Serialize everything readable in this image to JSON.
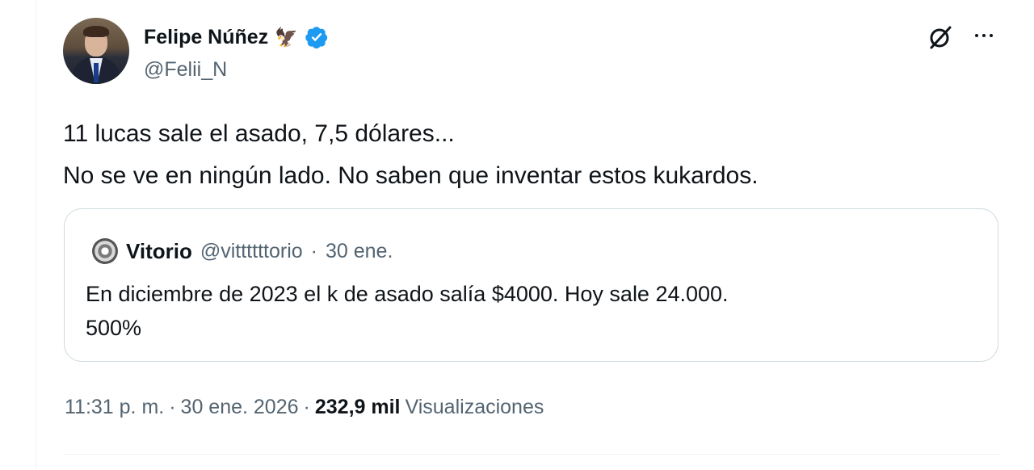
{
  "author": {
    "display_name": "Felipe Núñez",
    "emoji": "🦅",
    "handle": "@Felii_N",
    "verified_icon": "verified-badge-icon"
  },
  "actions": {
    "grok_icon": "grok-icon",
    "more_icon": "more-icon"
  },
  "tweet": {
    "text": "11 lucas sale el asado, 7,5 dólares...\nNo se ve en ningún lado. No saben que inventar estos kukardos."
  },
  "quote": {
    "name": "Vitorio",
    "handle": "@vittttttorio",
    "separator": "·",
    "date": "30 ene.",
    "text": "En diciembre de 2023 el k de asado salía $4000. Hoy sale 24.000.\n500%"
  },
  "meta": {
    "time": "11:31 p. m.",
    "sep1": "·",
    "date": "30 ene. 2026",
    "sep2": "·",
    "views_count": "232,9 mil",
    "views_label": "Visualizaciones"
  },
  "colors": {
    "accent_verified": "#1d9bf0",
    "text_primary": "#0f1419",
    "text_secondary": "#536471",
    "border": "#cfd9de"
  }
}
